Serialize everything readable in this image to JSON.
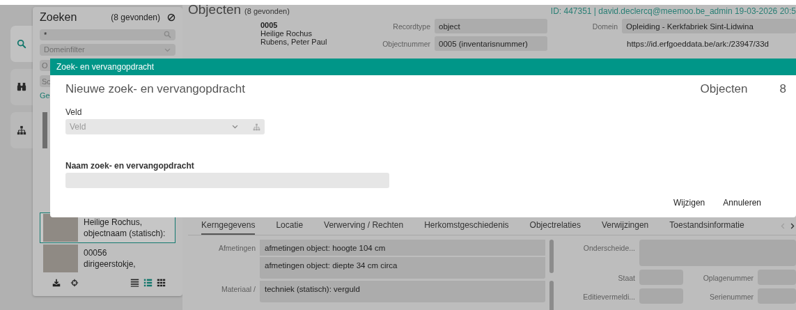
{
  "rail": [
    {
      "kind": "search",
      "selected": true
    },
    {
      "kind": "binoculars",
      "selected": false
    },
    {
      "kind": "sitemap",
      "selected": false
    }
  ],
  "search_panel": {
    "title": "Zoeken",
    "count": "(8 gevonden)",
    "query": "*",
    "domain_filter": {
      "placeholder": "Domeinfilter"
    },
    "field_3": "O",
    "field_4": "Sc",
    "link": "Ge",
    "results": [
      {
        "selected": true,
        "lines": [
          "Heilige Rochus,",
          "objectnaam (statisch):"
        ]
      },
      {
        "selected": false,
        "lines": [
          "00056",
          "dirigeerstokje,"
        ]
      }
    ],
    "actions": [
      {
        "kind": "download"
      },
      {
        "kind": "crosshair"
      }
    ],
    "view_modes": [
      {
        "kind": "lines",
        "selected": false
      },
      {
        "kind": "list",
        "selected": true
      },
      {
        "kind": "grid",
        "selected": false
      }
    ]
  },
  "main": {
    "title": "Objecten",
    "count": "(8 gevonden)",
    "status": "ID: 447351 | david.declercq@meemoo.be_admin 19-03-2026 20:5",
    "record": {
      "number": "0005",
      "title": "Heilige Rochus",
      "maker": "Rubens, Peter Paul"
    },
    "fields": [
      {
        "label": "Recordtype",
        "value": "object"
      },
      {
        "label": "Objectnummer",
        "value": "0005 (inventarisnummer)"
      }
    ],
    "domain": {
      "label": "Domein",
      "value": "Opleiding - Kerkfabriek Sint-Lidwina"
    },
    "uri": "https://id.erfgoeddata.be/ark:/23947/33d",
    "tabs": [
      {
        "label": "Kerngegevens",
        "selected": true
      },
      {
        "label": "Locatie",
        "selected": false
      },
      {
        "label": "Verwerving / Rechten",
        "selected": false
      },
      {
        "label": "Herkomstgeschiedenis",
        "selected": false
      },
      {
        "label": "Objectrelaties",
        "selected": false
      },
      {
        "label": "Verwijzingen",
        "selected": false
      },
      {
        "label": "Toestandsinformatie",
        "selected": false
      }
    ],
    "details_left": [
      {
        "label": "Afmetingen",
        "values": [
          "afmetingen object: hoogte 104 cm",
          "afmetingen object: diepte 34 cm circa"
        ]
      },
      {
        "label": "Materiaal /",
        "values": [
          "techniek (statisch): verguld"
        ]
      }
    ],
    "details_right": [
      {
        "label": "Onderscheide..."
      },
      {
        "label": "Staat"
      },
      {
        "label": "Oplagenummer"
      },
      {
        "label": "Editievermeldi..."
      },
      {
        "label": "Serienummer"
      }
    ]
  },
  "dialog": {
    "title": "Zoek- en vervangopdracht",
    "heading": "Nieuwe zoek- en vervangopdracht",
    "entity": "Objecten",
    "entity_count": "8",
    "field": {
      "label": "Veld",
      "placeholder": "Veld"
    },
    "name_field": {
      "label": "Naam zoek- en vervangopdracht"
    },
    "buttons": [
      "Wijzigen",
      "Annuleren"
    ]
  }
}
